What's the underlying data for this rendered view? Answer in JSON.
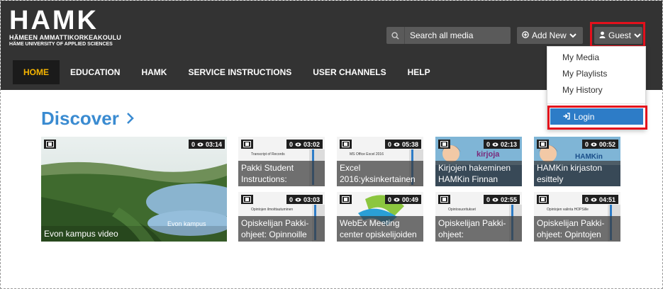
{
  "logo": {
    "main": "HAMK",
    "sub1": "HÄMEEN AMMATTIKORKEAKOULU",
    "sub2": "HÄME UNIVERSITY OF APPLIED SCIENCES"
  },
  "search": {
    "placeholder": "Search all media"
  },
  "header_buttons": {
    "add_new": "Add New",
    "guest": "Guest"
  },
  "nav": [
    "HOME",
    "EDUCATION",
    "HAMK",
    "SERVICE INSTRUCTIONS",
    "USER CHANNELS",
    "HELP"
  ],
  "dropdown": {
    "items": [
      "My Media",
      "My Playlists",
      "My History"
    ],
    "login": "Login"
  },
  "discover": {
    "title": "Discover"
  },
  "thumbs": [
    {
      "views": "0",
      "duration": "03:14",
      "title": "Evon kampus video",
      "overlay": "Evon kampus"
    },
    {
      "views": "0",
      "duration": "03:02",
      "title": "Pakki Student Instructions:",
      "mini": "Transcript of Records"
    },
    {
      "views": "0",
      "duration": "05:38",
      "title": "Excel 2016:yksinkertainen",
      "mini": "MS Office Excel 2016"
    },
    {
      "views": "0",
      "duration": "02:13",
      "title": "Kirjojen hakeminen HAMKin Finnan",
      "mini": "kirjoja"
    },
    {
      "views": "0",
      "duration": "00:52",
      "title": "HAMKin kirjaston esittely",
      "mini": "HAMKin"
    },
    {
      "views": "0",
      "duration": "03:03",
      "title": "Opiskelijan Pakki-ohjeet: Opinnoille",
      "mini": "Opintojen ilmoittautuminen"
    },
    {
      "views": "0",
      "duration": "00:49",
      "title": "WebEx Meeting center opiskelijoiden",
      "mini": ""
    },
    {
      "views": "0",
      "duration": "02:55",
      "title": "Opiskelijan Pakki-ohjeet:",
      "mini": "Opintosuoritukset"
    },
    {
      "views": "0",
      "duration": "04:51",
      "title": "Opiskelijan Pakki-ohjeet: Opintojen",
      "mini": "Opintojen valinta HOPSille"
    }
  ],
  "colors": {
    "header_bg": "#333333",
    "accent_blue": "#3a8bd1",
    "active_nav": "#f7b500",
    "highlight_red": "#e3101c",
    "login_blue": "#2d7cc7"
  }
}
